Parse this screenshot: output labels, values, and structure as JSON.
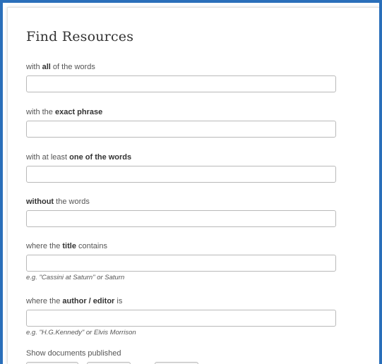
{
  "form": {
    "title": "Find Resources",
    "fields": [
      {
        "pre": "with ",
        "bold": "all",
        "post": " of the words",
        "value": ""
      },
      {
        "pre": "with the ",
        "bold": "exact phrase",
        "post": "",
        "value": ""
      },
      {
        "pre": "with at least ",
        "bold": "one of the words",
        "post": "",
        "value": ""
      },
      {
        "pre": "",
        "bold": "without",
        "post": " the words",
        "value": ""
      },
      {
        "pre": "where the ",
        "bold": "title",
        "post": " contains",
        "value": "",
        "hint": "e.g. \"Cassini at Saturn\" or Saturn"
      },
      {
        "pre": "where the ",
        "bold": "author / editor",
        "post": " is",
        "value": "",
        "hint": "e.g. \"H.G.Kennedy\" or Elvis Morrison"
      }
    ],
    "published_label": "Show documents published"
  }
}
